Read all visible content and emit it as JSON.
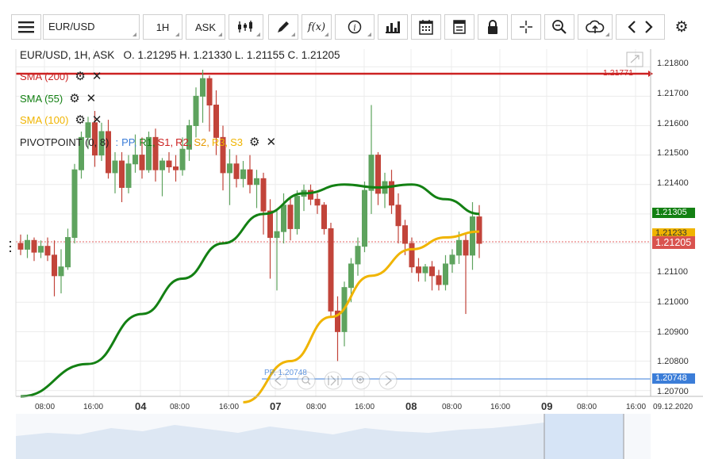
{
  "toolbar": {
    "menu_icon": "hamburger-menu-icon",
    "symbol": "EUR/USD",
    "timeframe": "1H",
    "price_type": "ASK",
    "chart_type_icon": "candlestick-icon",
    "draw_icon": "pencil-icon",
    "function_label": "f(x)",
    "info_icon": "info-icon",
    "volume_icon": "bar-chart-icon",
    "calendar_icon": "calendar-icon",
    "layout_icon": "layout-icon",
    "lock_icon": "lock-icon",
    "crosshair_icon": "crosshair-icon",
    "zoom_icon": "zoom-icon",
    "cloud_icon": "cloud-upload-icon",
    "prev_icon": "chevron-left-icon",
    "next_icon": "chevron-right-icon",
    "settings_icon": "gear-icon"
  },
  "header": {
    "ohlc": "EUR/USD, 1H, ASK   O. 1.21295 H. 1.21330 L. 1.21155 C. 1.21205"
  },
  "indicators": {
    "sma200": "SMA (200)",
    "sma55": "SMA (55)",
    "sma100": "SMA (100)",
    "pivot_name": "PIVOTPOINT (0, 8)",
    "pivot_sep": ":",
    "pivot_parts": [
      "PP,",
      "R1,",
      "S1,",
      "R2,",
      "S2,",
      "R3,",
      "S3"
    ]
  },
  "colors": {
    "sma200": "#cc2222",
    "sma55": "#138013",
    "sma100": "#f0b400",
    "pp": "#3b7dd8",
    "up": "#5ea35e",
    "down": "#c2443a"
  },
  "price_axis": {
    "ticks": [
      "1.21800",
      "1.21700",
      "1.21600",
      "1.21500",
      "1.21400",
      "1.21300",
      "1.21100",
      "1.21000",
      "1.20900",
      "1.20800",
      "1.20700"
    ],
    "tag_sma200": "1.21771",
    "tag_sma55": "1.21305",
    "tag_sma100": "1.21233",
    "tag_last": "1.21205",
    "tag_pp": "1.20748",
    "pp_label": "PP, 1.20748"
  },
  "time_axis": {
    "labels": [
      "08:00",
      "16:00",
      "04",
      "08:00",
      "16:00",
      "07",
      "08:00",
      "16:00",
      "08",
      "08:00",
      "16:00",
      "09",
      "08:00",
      "16:00",
      "09.12.2020"
    ]
  },
  "chart_data": {
    "type": "candlestick",
    "symbol": "EUR/USD",
    "interval": "1H",
    "last": {
      "open": 1.21295,
      "high": 1.2133,
      "low": 1.21155,
      "close": 1.21205
    },
    "ylim": [
      1.2068,
      1.2186
    ],
    "levels": {
      "sma200": 1.21771,
      "sma55": 1.21305,
      "sma100": 1.21233,
      "pp": 1.20748,
      "last": 1.21205
    },
    "candles": [
      [
        1.212,
        1.2123,
        1.2116,
        1.2118
      ],
      [
        1.2118,
        1.2123,
        1.2115,
        1.2121
      ],
      [
        1.2121,
        1.2122,
        1.2114,
        1.2117
      ],
      [
        1.2117,
        1.2121,
        1.2115,
        1.2119
      ],
      [
        1.2119,
        1.2122,
        1.2114,
        1.2116
      ],
      [
        1.2116,
        1.2121,
        1.2102,
        1.2109
      ],
      [
        1.2109,
        1.2118,
        1.2103,
        1.2112
      ],
      [
        1.2112,
        1.2125,
        1.2111,
        1.2122
      ],
      [
        1.2122,
        1.2147,
        1.212,
        1.2145
      ],
      [
        1.2145,
        1.2158,
        1.2142,
        1.2156
      ],
      [
        1.2156,
        1.2163,
        1.2152,
        1.2161
      ],
      [
        1.2161,
        1.2165,
        1.2146,
        1.215
      ],
      [
        1.215,
        1.2161,
        1.2148,
        1.2158
      ],
      [
        1.2158,
        1.2162,
        1.2142,
        1.2144
      ],
      [
        1.2144,
        1.2151,
        1.2137,
        1.2148
      ],
      [
        1.2148,
        1.2151,
        1.2134,
        1.2139
      ],
      [
        1.2139,
        1.215,
        1.2137,
        1.2147
      ],
      [
        1.2147,
        1.2157,
        1.2144,
        1.215
      ],
      [
        1.215,
        1.2156,
        1.2142,
        1.2145
      ],
      [
        1.2145,
        1.2158,
        1.2144,
        1.2156
      ],
      [
        1.2156,
        1.2159,
        1.2141,
        1.2145
      ],
      [
        1.2145,
        1.2149,
        1.2136,
        1.2148
      ],
      [
        1.2148,
        1.2151,
        1.2144,
        1.2146
      ],
      [
        1.2146,
        1.215,
        1.2141,
        1.2145
      ],
      [
        1.2145,
        1.2156,
        1.2143,
        1.2152
      ],
      [
        1.2152,
        1.2162,
        1.2148,
        1.216
      ],
      [
        1.216,
        1.2173,
        1.2156,
        1.217
      ],
      [
        1.217,
        1.2179,
        1.2161,
        1.2176
      ],
      [
        1.2176,
        1.2177,
        1.2158,
        1.2167
      ],
      [
        1.2167,
        1.2172,
        1.215,
        1.2156
      ],
      [
        1.2156,
        1.216,
        1.2138,
        1.2144
      ],
      [
        1.2144,
        1.2152,
        1.2133,
        1.2147
      ],
      [
        1.2147,
        1.215,
        1.2139,
        1.2142
      ],
      [
        1.2142,
        1.2148,
        1.2139,
        1.2145
      ],
      [
        1.2145,
        1.215,
        1.2137,
        1.214
      ],
      [
        1.214,
        1.2145,
        1.2132,
        1.2142
      ],
      [
        1.2142,
        1.2144,
        1.2123,
        1.2131
      ],
      [
        1.2131,
        1.2135,
        1.2108,
        1.2122
      ],
      [
        1.2122,
        1.2131,
        1.2104,
        1.2124
      ],
      [
        1.2124,
        1.2137,
        1.212,
        1.2133
      ],
      [
        1.2133,
        1.2136,
        1.2121,
        1.2125
      ],
      [
        1.2125,
        1.2138,
        1.2123,
        1.2136
      ],
      [
        1.2136,
        1.214,
        1.2131,
        1.2138
      ],
      [
        1.2138,
        1.214,
        1.2133,
        1.2135
      ],
      [
        1.2135,
        1.2137,
        1.213,
        1.2133
      ],
      [
        1.2133,
        1.2134,
        1.2123,
        1.2125
      ],
      [
        1.2125,
        1.2127,
        1.2095,
        1.2097
      ],
      [
        1.2097,
        1.2102,
        1.208,
        1.209
      ],
      [
        1.209,
        1.2107,
        1.2085,
        1.2105
      ],
      [
        1.2105,
        1.2115,
        1.21,
        1.2113
      ],
      [
        1.2113,
        1.2122,
        1.2109,
        1.2119
      ],
      [
        1.2119,
        1.2141,
        1.2117,
        1.2138
      ],
      [
        1.2138,
        1.2167,
        1.213,
        1.215
      ],
      [
        1.215,
        1.2151,
        1.2133,
        1.2137
      ],
      [
        1.2137,
        1.2144,
        1.2132,
        1.2141
      ],
      [
        1.2141,
        1.2145,
        1.213,
        1.2133
      ],
      [
        1.2133,
        1.2137,
        1.212,
        1.2126
      ],
      [
        1.2126,
        1.2128,
        1.2116,
        1.212
      ],
      [
        1.212,
        1.2122,
        1.211,
        1.2112
      ],
      [
        1.2112,
        1.2115,
        1.2107,
        1.211
      ],
      [
        1.211,
        1.2113,
        1.2107,
        1.2112
      ],
      [
        1.2112,
        1.2114,
        1.2104,
        1.2109
      ],
      [
        1.2109,
        1.2111,
        1.2104,
        1.2106
      ],
      [
        1.2106,
        1.2116,
        1.2104,
        1.2113
      ],
      [
        1.2113,
        1.2118,
        1.211,
        1.2116
      ],
      [
        1.2116,
        1.2124,
        1.2113,
        1.2121
      ],
      [
        1.2121,
        1.2123,
        1.2096,
        1.2116
      ],
      [
        1.2116,
        1.2134,
        1.2111,
        1.2129
      ],
      [
        1.2129,
        1.2133,
        1.2115,
        1.212
      ]
    ],
    "sma55_curve": [
      [
        0,
        1.2068
      ],
      [
        10,
        1.2079
      ],
      [
        18,
        1.2096
      ],
      [
        24,
        1.2108
      ],
      [
        30,
        1.212
      ],
      [
        36,
        1.213
      ],
      [
        42,
        1.2137
      ],
      [
        48,
        1.214
      ],
      [
        53,
        1.2139
      ],
      [
        58,
        1.214
      ],
      [
        63,
        1.2135
      ],
      [
        68,
        1.213
      ]
    ],
    "sma100_curve": [
      [
        33,
        1.2066
      ],
      [
        40,
        1.208
      ],
      [
        46,
        1.2095
      ],
      [
        52,
        1.2109
      ],
      [
        58,
        1.2118
      ],
      [
        63,
        1.2122
      ],
      [
        68,
        1.2124
      ]
    ]
  }
}
